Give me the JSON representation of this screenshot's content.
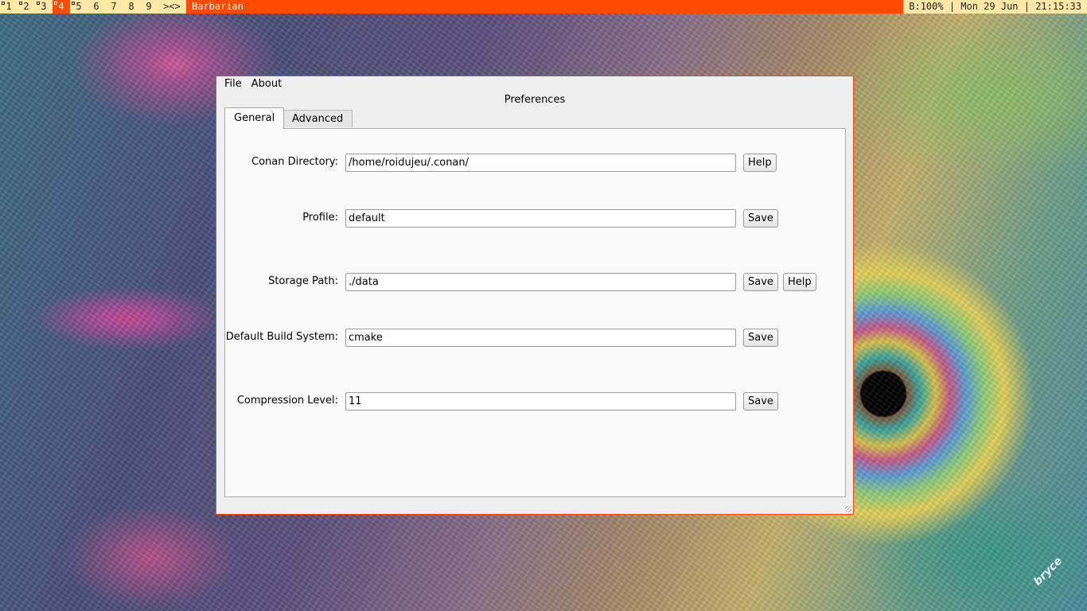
{
  "topbar": {
    "workspaces": [
      "1",
      "2",
      "3",
      "4",
      "5",
      "6",
      "7",
      "8",
      "9"
    ],
    "more_label": "><>",
    "active_workspace": "4",
    "window_title": "Barbarian",
    "status": "B:100% | Mon 29 Jun | 21:15:33"
  },
  "app": {
    "menus": [
      "File",
      "About"
    ],
    "title": "Preferences",
    "tabs": [
      "General",
      "Advanced"
    ],
    "selected_tab": "General",
    "fields": {
      "conan_directory": {
        "label": "Conan Directory:",
        "value": "/home/roidujeu/.conan/",
        "buttons": [
          "Help"
        ]
      },
      "profile": {
        "label": "Profile:",
        "value": "default",
        "buttons": [
          "Save"
        ]
      },
      "storage_path": {
        "label": "Storage Path:",
        "value": "./data",
        "buttons": [
          "Save",
          "Help"
        ]
      },
      "default_build_system": {
        "label": "Default Build System:",
        "value": "cmake",
        "buttons": [
          "Save"
        ]
      },
      "compression_level": {
        "label": "Compression Level:",
        "value": "11",
        "buttons": [
          "Save"
        ]
      }
    }
  },
  "wallpaper": {
    "signature": "bryce"
  }
}
